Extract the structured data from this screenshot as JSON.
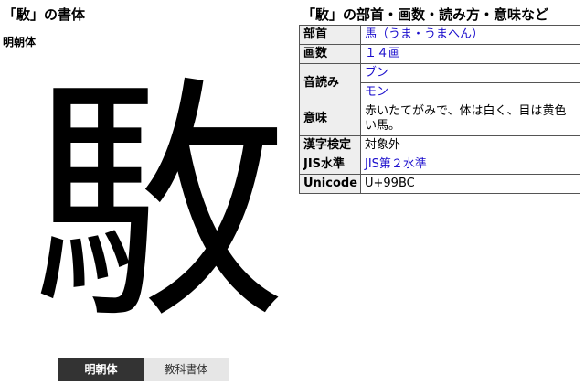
{
  "left": {
    "title": "「駇」の書体",
    "font_label": "明朝体",
    "glyph": "駇",
    "toggle": {
      "active": "明朝体",
      "inactive": "教科書体"
    }
  },
  "right": {
    "title": "「駇」の部首・画数・読み方・意味など",
    "rows": {
      "radical": {
        "label": "部首",
        "value": "馬（うま・うまへん）"
      },
      "strokes": {
        "label": "画数",
        "value": "１４画"
      },
      "reading": {
        "label": "音読み",
        "values": [
          "ブン",
          "モン"
        ]
      },
      "meaning": {
        "label": "意味",
        "value": "赤いたてがみで、体は白く、目は黄色い馬。"
      },
      "kanken": {
        "label": "漢字検定",
        "value": "対象外"
      },
      "jis": {
        "label": "JIS水準",
        "value": "JIS第２水準"
      },
      "unicode": {
        "label": "Unicode",
        "value": "U+99BC"
      }
    }
  },
  "colors": {
    "link": "#1a0dcc",
    "toggle_active_bg": "#333333",
    "toggle_inactive_bg": "#e6e6e6",
    "header_bg": "#eeeeee"
  }
}
